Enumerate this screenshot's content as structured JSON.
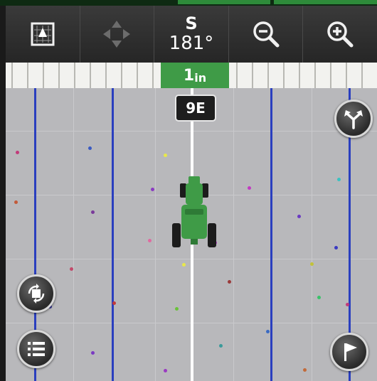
{
  "toolbar": {
    "buttons": [
      {
        "icon": "map-view-icon"
      },
      {
        "icon": "pan-arrows-icon"
      },
      {
        "icon": "heading-display"
      },
      {
        "icon": "zoom-out-icon"
      },
      {
        "icon": "zoom-in-icon"
      }
    ],
    "heading_direction": "S",
    "heading_degrees": "181°"
  },
  "lightbar": {
    "offset_value": "1",
    "offset_unit": "in"
  },
  "map": {
    "pass_label": "9E",
    "colors": {
      "guidance_line": "#ffffff",
      "pass_lines": "#2a3fbf",
      "field": "#b8b8bb",
      "tractor": "#3f9b47"
    }
  },
  "side_buttons": [
    {
      "icon": "shift-track-icon"
    },
    {
      "icon": "rotate-view-icon"
    },
    {
      "icon": "menu-list-icon"
    },
    {
      "icon": "flag-icon"
    }
  ]
}
